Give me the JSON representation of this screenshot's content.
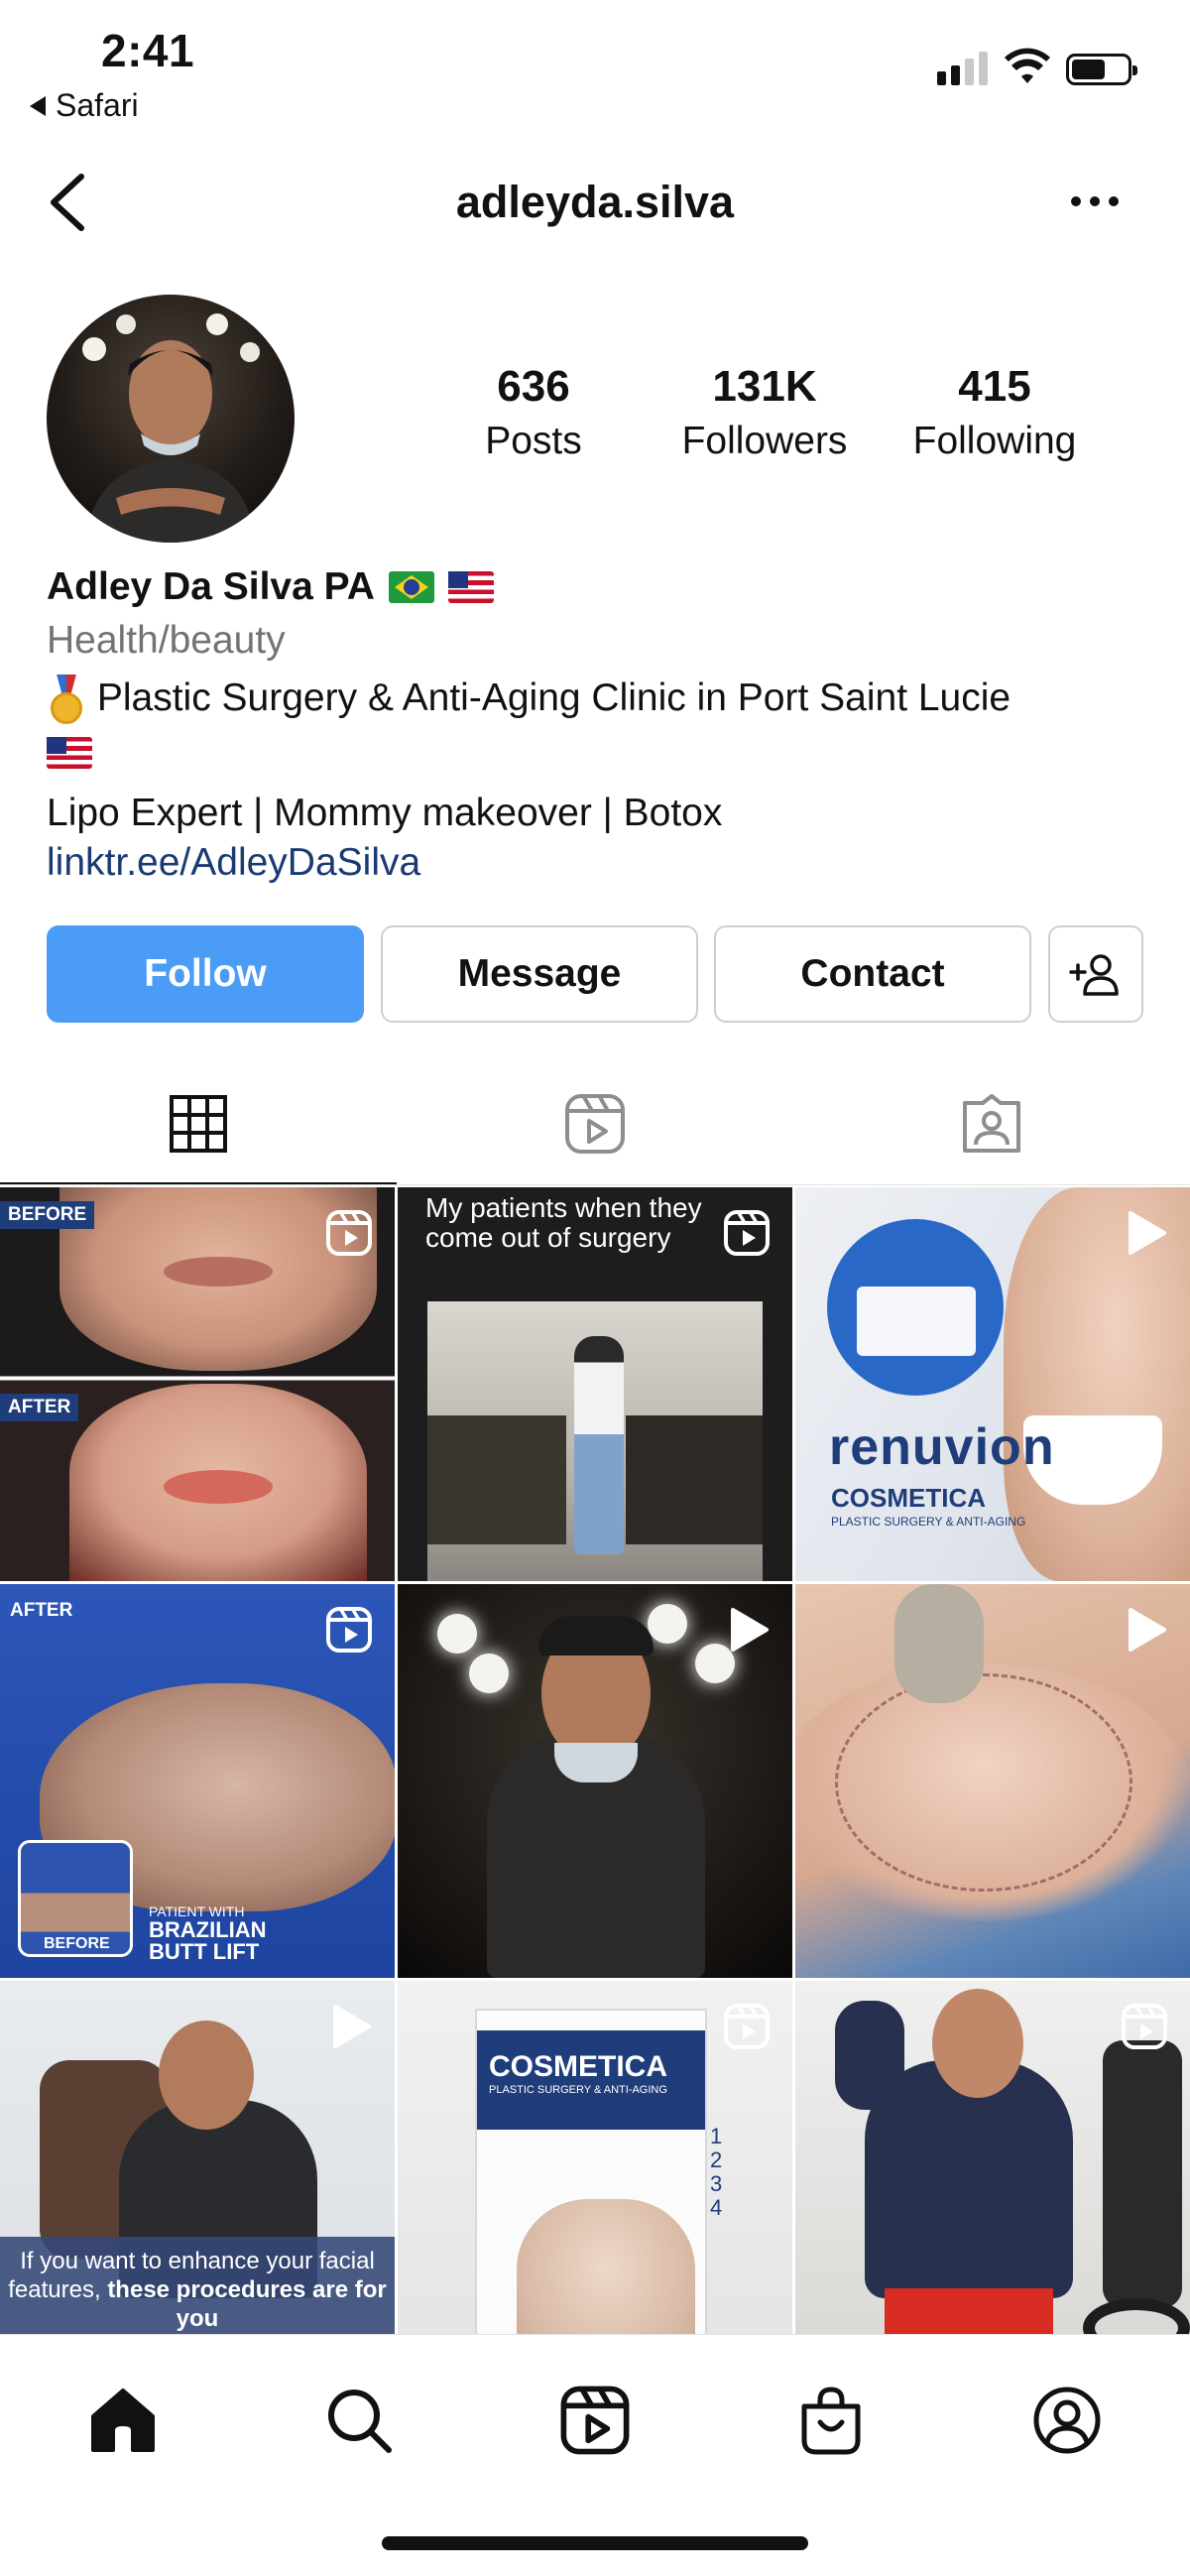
{
  "status_bar": {
    "time": "2:41",
    "back_app": "Safari",
    "battery_percent": 62
  },
  "header": {
    "username": "adleyda.silva"
  },
  "profile": {
    "stats": [
      {
        "value": "636",
        "label": "Posts"
      },
      {
        "value": "131K",
        "label": "Followers"
      },
      {
        "value": "415",
        "label": "Following"
      }
    ],
    "display_name": "Adley Da Silva PA",
    "category": "Health/beauty",
    "bio_line_1": "Plastic Surgery & Anti-Aging Clinic in Port Saint Lucie",
    "bio_line_2": "Lipo Expert | Mommy makeover | Botox",
    "link": "linktr.ee/AdleyDaSilva"
  },
  "actions": {
    "follow": "Follow",
    "message": "Message",
    "contact": "Contact"
  },
  "tabs": [
    {
      "name": "grid",
      "icon": "grid-icon",
      "active": true
    },
    {
      "name": "reels",
      "icon": "reels-icon",
      "active": false
    },
    {
      "name": "tagged",
      "icon": "tagged-icon",
      "active": false
    }
  ],
  "posts": [
    {
      "type": "reel",
      "tags": [
        "BEFORE",
        "AFTER"
      ]
    },
    {
      "type": "reel",
      "caption": "My patients when they come out of surgery"
    },
    {
      "type": "video",
      "brand": "renuvion",
      "brand_sub": "COSMETICA",
      "brand_sub2": "PLASTIC SURGERY & ANTI-AGING"
    },
    {
      "type": "reel",
      "tags": [
        "AFTER",
        "BEFORE"
      ],
      "note_small": "PATIENT WITH",
      "note": "BRAZILIAN BUTT LIFT"
    },
    {
      "type": "video"
    },
    {
      "type": "video"
    },
    {
      "type": "video",
      "caption_regular": "If you want to enhance your facial features,",
      "caption_bold": "these procedures are for you"
    },
    {
      "type": "reel",
      "brand": "COSMETICA",
      "brand_sub": "PLASTIC SURGERY & ANTI-AGING",
      "steps": [
        "1",
        "2",
        "3",
        "4"
      ]
    },
    {
      "type": "reel"
    }
  ],
  "bottom_nav": [
    {
      "name": "home",
      "icon": "home-icon",
      "active": true
    },
    {
      "name": "search",
      "icon": "search-icon",
      "active": false
    },
    {
      "name": "reels",
      "icon": "reels-icon",
      "active": false
    },
    {
      "name": "shop",
      "icon": "shop-icon",
      "active": false
    },
    {
      "name": "profile",
      "icon": "profile-icon",
      "active": false
    }
  ],
  "colors": {
    "follow_button": "#4a9cf6",
    "link": "#1a3a73",
    "category_text": "#737373"
  }
}
